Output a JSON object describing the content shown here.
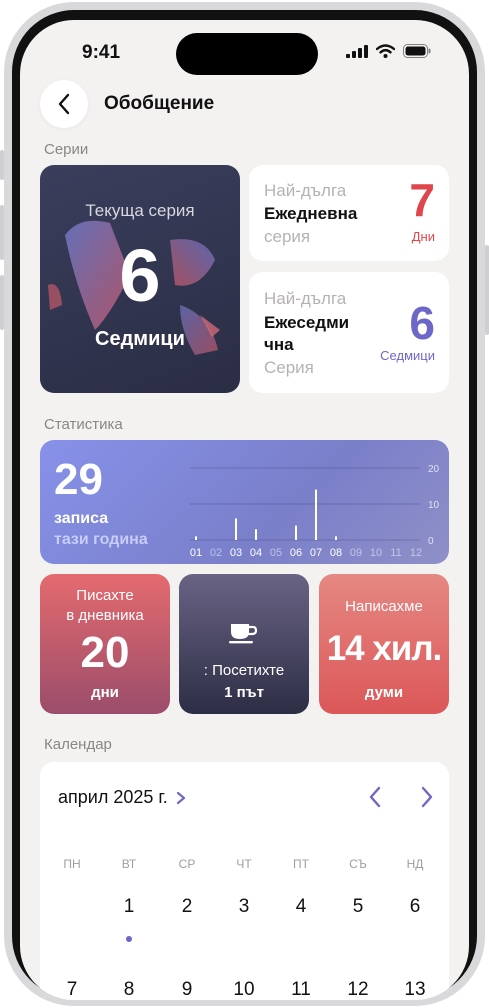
{
  "status": {
    "time": "9:41"
  },
  "header": {
    "title": "Обобщение"
  },
  "sections": {
    "series": "Серии",
    "stats": "Статистика",
    "calendar": "Календар"
  },
  "current_series": {
    "label": "Текуща серия",
    "value": "6",
    "unit": "Седмици"
  },
  "longest_daily": {
    "line1": "Най-дълга",
    "line2": "Ежедневна",
    "line3": "серия",
    "value": "7",
    "unit": "Дни",
    "color": "#e0474c"
  },
  "longest_weekly": {
    "line1": "Най-дълга",
    "line2a": "Ежеседми",
    "line2b": "чна",
    "line3": "Серия",
    "value": "6",
    "unit": "Седмици",
    "color": "#6d67c7"
  },
  "stats": {
    "count": "29",
    "count_label": "записа",
    "period_label": "тази година",
    "y_ticks": [
      "20",
      "10",
      "0"
    ],
    "months": [
      "01",
      "02",
      "03",
      "04",
      "05",
      "06",
      "07",
      "08",
      "09",
      "10",
      "11",
      "12"
    ],
    "monthly_values": [
      1,
      0,
      6,
      3,
      0,
      4,
      14,
      1,
      0,
      0,
      0,
      0
    ]
  },
  "tiles": {
    "journal": {
      "line1": "Писахте",
      "line2": "в дневника",
      "value": "20",
      "unit": "дни"
    },
    "visited": {
      "icon": "coffee-cup-icon",
      "line1": ": Посетихте",
      "line2": "1 път"
    },
    "words": {
      "line1": "Написахме",
      "value": "14 хил.",
      "unit": "думи"
    }
  },
  "calendar": {
    "month": "април 2025 г.",
    "weekdays": [
      "ПН",
      "ВТ",
      "СР",
      "ЧТ",
      "ПТ",
      "СЪ",
      "НД"
    ],
    "week1": [
      "1",
      "2",
      "3",
      "4",
      "5",
      "6"
    ],
    "week2": [
      "7",
      "8",
      "9",
      "10",
      "11",
      "12",
      "13"
    ],
    "accent": "#6d67c7"
  }
}
